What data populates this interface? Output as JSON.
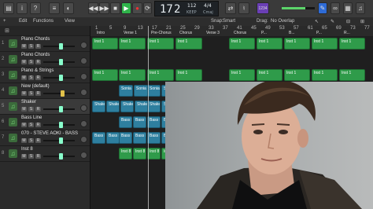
{
  "transport": {
    "lcd_bar": "17",
    "lcd_beat": "2",
    "tempo": "112",
    "tempo_sub": "KEEP",
    "sig_top": "4/4",
    "key": "Cmaj",
    "cpu_badge": "1234"
  },
  "menu": {
    "edit": "Edit",
    "functions": "Functions",
    "view": "View",
    "snap_label": "Snap:",
    "snap_value": "Smart",
    "drag_label": "Drag:",
    "drag_value": "No Overlap"
  },
  "ruler": [
    "1",
    "5",
    "9",
    "13",
    "17",
    "21",
    "25",
    "29",
    "33",
    "37",
    "41",
    "45",
    "49",
    "53",
    "57",
    "61",
    "65",
    "69",
    "73",
    "77"
  ],
  "markers": [
    "Intro",
    "Verse 1",
    "Pre-Chorus",
    "Chorus",
    "Verse 3",
    "Chorus",
    "P...",
    "B...",
    "P...",
    "R..."
  ],
  "tracks": [
    {
      "num": "1",
      "name": "Piano Chords"
    },
    {
      "num": "2",
      "name": "Piano Chords"
    },
    {
      "num": "3",
      "name": "Piano & Strings"
    },
    {
      "num": "4",
      "name": "New (default)"
    },
    {
      "num": "5",
      "name": "Shaker"
    },
    {
      "num": "6",
      "name": "Bass Line"
    },
    {
      "num": "7",
      "name": "070 - STEVE AOKI - BASS"
    },
    {
      "num": "8",
      "name": "Inst 8"
    }
  ],
  "regions": {
    "inst": "Inst 1",
    "sonia": "Sonia Fo",
    "sonia_mix": "Sonia For Mix",
    "shaker": "Shaker",
    "bass": "Bass Lin",
    "bass2": "Bass Li",
    "inst8": "Inst 8"
  },
  "colors": {
    "midi_region": "#2f9b4a",
    "audio_region": "#2e7f9f",
    "play": "#2fb34a"
  }
}
